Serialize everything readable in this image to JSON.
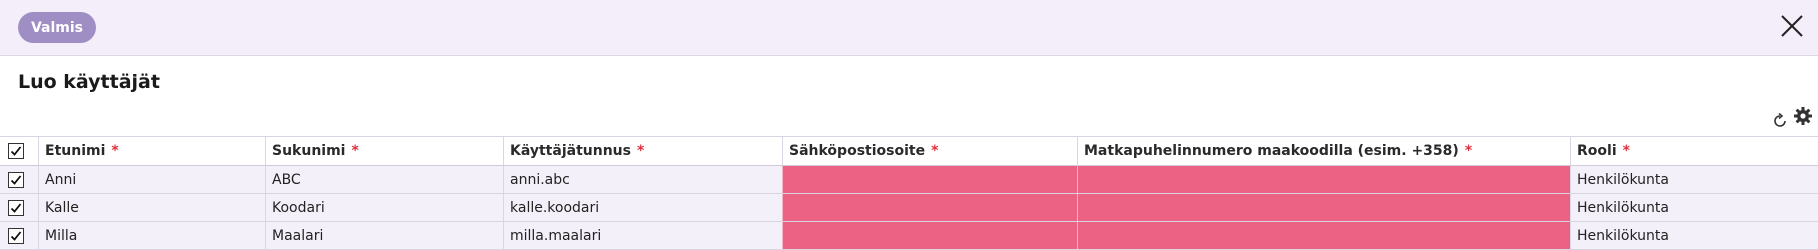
{
  "toolbar": {
    "done_label": "Valmis"
  },
  "page": {
    "title": "Luo käyttäjät"
  },
  "table": {
    "columns": [
      {
        "label": "Etunimi",
        "required_mark": "*"
      },
      {
        "label": "Sukunimi",
        "required_mark": "*"
      },
      {
        "label": "Käyttäjätunnus",
        "required_mark": "*"
      },
      {
        "label": "Sähköpostiosoite",
        "required_mark": "*"
      },
      {
        "label": "Matkapuhelinnumero maakoodilla (esim. +358)",
        "required_mark": "*"
      },
      {
        "label": "Rooli",
        "required_mark": "*"
      }
    ],
    "rows": [
      {
        "checked": true,
        "first_name": "Anni",
        "last_name": "ABC",
        "username": "anni.abc",
        "email": "",
        "phone": "",
        "role": "Henkilökunta"
      },
      {
        "checked": true,
        "first_name": "Kalle",
        "last_name": "Koodari",
        "username": "kalle.koodari",
        "email": "",
        "phone": "",
        "role": "Henkilökunta"
      },
      {
        "checked": true,
        "first_name": "Milla",
        "last_name": "Maalari",
        "username": "milla.maalari",
        "email": "",
        "phone": "",
        "role": "Henkilökunta"
      }
    ]
  },
  "colors": {
    "topbar_bg": "#f3eefa",
    "done_button": "#9f8ec4",
    "invalid_cell": "#ec6284",
    "required_asterisk": "#e0303b",
    "row_bg": "#f4f0fa"
  },
  "icons": {
    "close": "close-icon",
    "refresh": "refresh-icon",
    "settings": "gear-icon",
    "checkbox": "checkmark-icon"
  }
}
